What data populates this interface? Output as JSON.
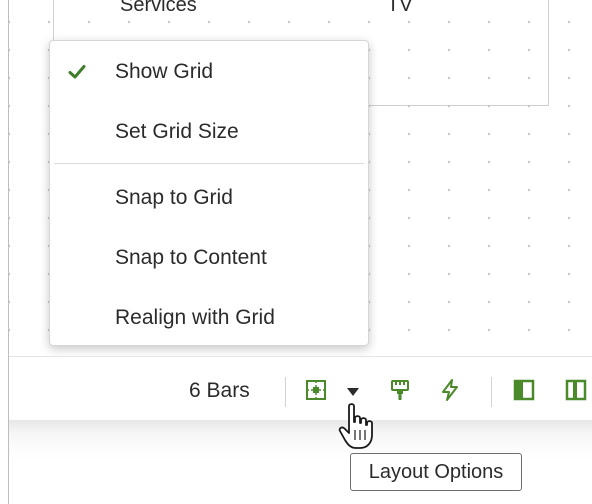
{
  "canvas": {
    "labels": [
      "Services",
      "TV"
    ]
  },
  "menu": {
    "items": [
      {
        "label": "Show Grid",
        "checked": true,
        "icon": "checkmark-icon"
      },
      {
        "label": "Set Grid Size",
        "checked": false
      },
      {
        "label": "Snap to Grid",
        "checked": false
      },
      {
        "label": "Snap to Content",
        "checked": false
      },
      {
        "label": "Realign with Grid",
        "checked": false
      }
    ]
  },
  "toolbar": {
    "bars_count": "6 Bars",
    "icons": [
      "grid-layout-icon",
      "caret-down-icon",
      "format-brush-icon",
      "lightning-bolt-icon",
      "left-panel-icon",
      "split-panel-icon"
    ]
  },
  "tooltip": {
    "text": "Layout Options"
  },
  "colors": {
    "accent_green": "#4b8a2a",
    "check_green": "#3f7d2a"
  }
}
